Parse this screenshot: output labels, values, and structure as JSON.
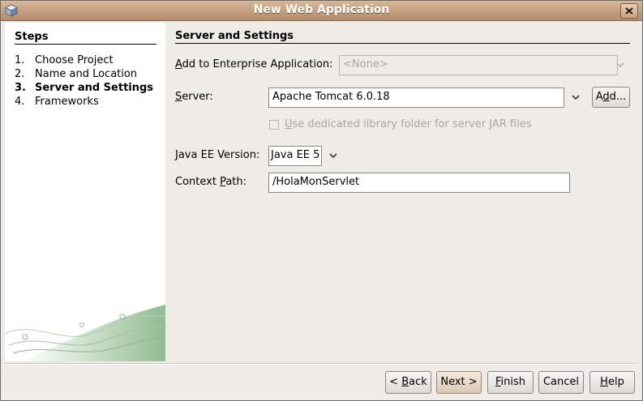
{
  "window": {
    "title": "New Web Application"
  },
  "steps": {
    "title": "Steps",
    "items": [
      {
        "num": "1.",
        "label": "Choose Project"
      },
      {
        "num": "2.",
        "label": "Name and Location"
      },
      {
        "num": "3.",
        "label": "Server and Settings"
      },
      {
        "num": "4.",
        "label": "Frameworks"
      }
    ],
    "current_index": 2
  },
  "panel": {
    "title": "Server and Settings",
    "enterprise": {
      "label_first": "A",
      "label_rest": "dd to Enterprise Application:",
      "value": "<None>",
      "disabled": true
    },
    "server": {
      "label_first": "S",
      "label_rest": "erver:",
      "value": "Apache Tomcat 6.0.18",
      "add_button_pre": "A",
      "add_button_u": "d",
      "add_button_post": "d..."
    },
    "dedicated_library": {
      "label_first": "U",
      "label_rest": "se dedicated library folder for server JAR files",
      "checked": false,
      "disabled": true
    },
    "java_ee": {
      "label_first": "J",
      "label_rest": "ava EE Version:",
      "value": "Java EE 5"
    },
    "context_path": {
      "label_pre": "Context ",
      "label_u": "P",
      "label_post": "ath:",
      "value": "/HolaMonServlet"
    }
  },
  "buttons": {
    "back_pre": "< ",
    "back_u": "B",
    "back_post": "ack",
    "next": "Next >",
    "finish_u": "F",
    "finish_post": "inish",
    "cancel": "Cancel",
    "help_u": "H",
    "help_post": "elp"
  },
  "colors": {
    "titlebar": "#b28b6a",
    "window_bg": "#efebe7",
    "steps_bg": "#ffffff",
    "decor_green": "#7fb07f"
  }
}
